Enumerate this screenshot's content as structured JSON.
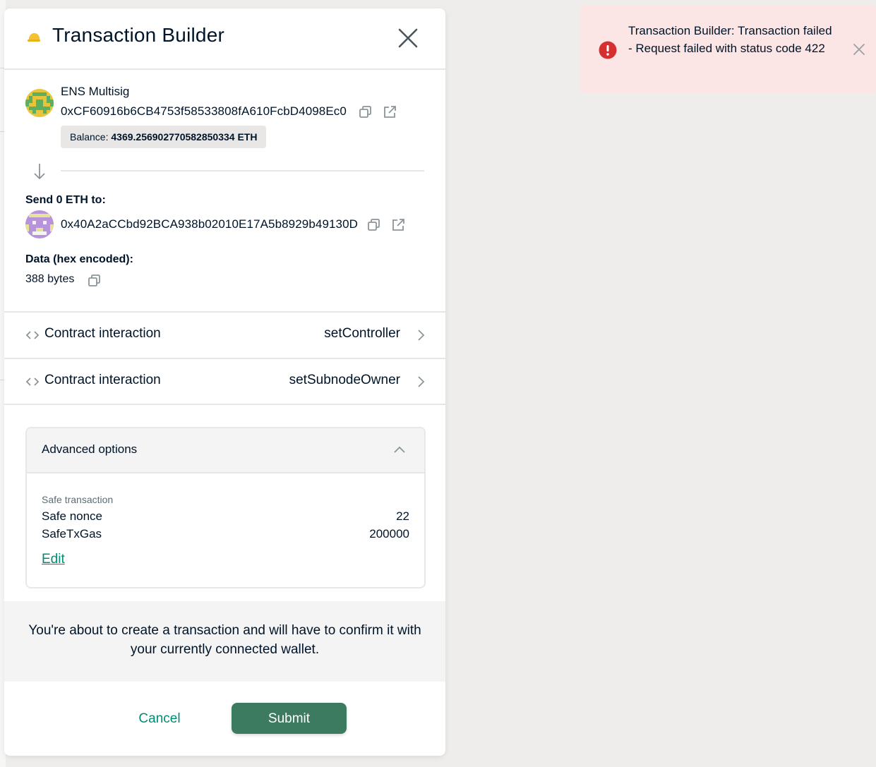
{
  "modal": {
    "title": "Transaction Builder",
    "sender": {
      "name": "ENS Multisig",
      "address": "0xCF60916b6CB4753f58533808fA610FcbD4098Ec0",
      "balance_label": "Balance:",
      "balance_value": "4369.256902770582850334 ETH"
    },
    "recipient": {
      "label": "Send 0 ETH to:",
      "address": "0x40A2aCCbd92BCA938b02010E17A5b8929b49130D"
    },
    "data": {
      "label": "Data (hex encoded):",
      "value": "388 bytes"
    },
    "interactions": [
      {
        "label": "Contract interaction",
        "method": "setController"
      },
      {
        "label": "Contract interaction",
        "method": "setSubnodeOwner"
      }
    ],
    "advanced": {
      "title": "Advanced options",
      "section": "Safe transaction",
      "rows": [
        {
          "key": "Safe nonce",
          "value": "22"
        },
        {
          "key": "SafeTxGas",
          "value": "200000"
        }
      ],
      "edit_label": "Edit"
    },
    "info": "You're about to create a transaction and will have to confirm it with your currently connected wallet.",
    "cancel_label": "Cancel",
    "submit_label": "Submit"
  },
  "toast": {
    "message": "Transaction Builder: Transaction failed - Request failed with status code 422"
  },
  "colors": {
    "primary": "#3d7b61",
    "link": "#008c73",
    "error": "#d62f2f",
    "toast_bg": "#fbe5e5"
  },
  "icons": [
    "app-icon",
    "close-icon",
    "copy-icon",
    "external-link-icon",
    "arrow-down-icon",
    "code-icon",
    "chevron-right-icon",
    "chevron-up-icon",
    "error-icon"
  ]
}
